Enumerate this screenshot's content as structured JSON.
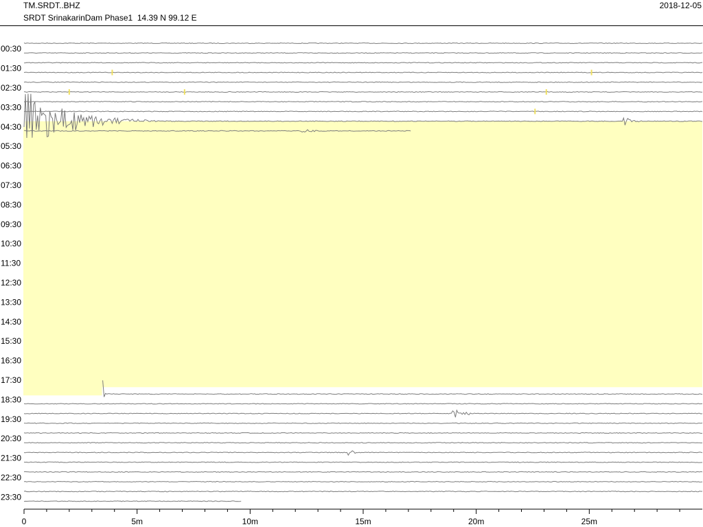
{
  "header": {
    "station": "TM.SRDT..BHZ",
    "site": "SRDT SrinakarinDam Phase1  14.39 N 99.12 E",
    "date": "2018-12-05"
  },
  "colors": {
    "trace": "#7a7a7a",
    "highlight": "#ffffc0",
    "pick_marker": "#f0e060",
    "axis": "#000000"
  },
  "chart_data": {
    "type": "line",
    "title": "",
    "xlabel": "",
    "ylabel": "",
    "x_unit": "minutes",
    "xlim": [
      0,
      30
    ],
    "x_ticks": [
      {
        "value": 0,
        "label": "0"
      },
      {
        "value": 5,
        "label": "5m"
      },
      {
        "value": 10,
        "label": "10m"
      },
      {
        "value": 15,
        "label": "15m"
      },
      {
        "value": 20,
        "label": "20m"
      },
      {
        "value": 25,
        "label": "25m"
      }
    ],
    "x_minor_step": 1,
    "row_minutes": 30,
    "row_count": 48,
    "row_labels": [
      "00:30",
      "01:30",
      "02:30",
      "03:30",
      "04:30",
      "05:30",
      "06:30",
      "07:30",
      "08:30",
      "09:30",
      "10:30",
      "11:30",
      "12:30",
      "13:30",
      "14:30",
      "15:30",
      "16:30",
      "17:30",
      "18:30",
      "19:30",
      "20:30",
      "21:30",
      "22:30",
      "23:30"
    ],
    "highlight_region": {
      "start_row": 8,
      "start_min": 0.05,
      "end_row": 36,
      "end_min": 3.45
    },
    "data_gap": {
      "start_row": 9,
      "start_min": 17.1,
      "end_row": 36,
      "end_min": 3.45
    },
    "data_end": {
      "row": 47,
      "min": 9.6
    },
    "events": [
      {
        "label": "main shock",
        "row": 8,
        "start_min": 0.0,
        "duration_min": 7.0,
        "peak_amp_rows": 3.4
      },
      {
        "label": "aftershock",
        "row": 9,
        "start_min": 12.3,
        "duration_min": 2.4,
        "peak_amp_rows": 0.3
      },
      {
        "label": "aftershock",
        "row": 8,
        "start_min": 26.5,
        "duration_min": 1.8,
        "peak_amp_rows": 0.5
      },
      {
        "label": "spike",
        "row": 36,
        "start_min": 3.45,
        "duration_min": 0.2,
        "peak_amp_rows": 3.8
      },
      {
        "label": "event",
        "row": 38,
        "start_min": 18.9,
        "duration_min": 2.5,
        "peak_amp_rows": 0.55
      },
      {
        "label": "event",
        "row": 42,
        "start_min": 14.3,
        "duration_min": 1.5,
        "peak_amp_rows": 0.35
      }
    ],
    "pick_markers": [
      {
        "row": 3,
        "min": 3.9
      },
      {
        "row": 3,
        "min": 25.1
      },
      {
        "row": 5,
        "min": 2.0
      },
      {
        "row": 5,
        "min": 7.1
      },
      {
        "row": 5,
        "min": 23.1
      },
      {
        "row": 7,
        "min": 22.6
      }
    ]
  }
}
